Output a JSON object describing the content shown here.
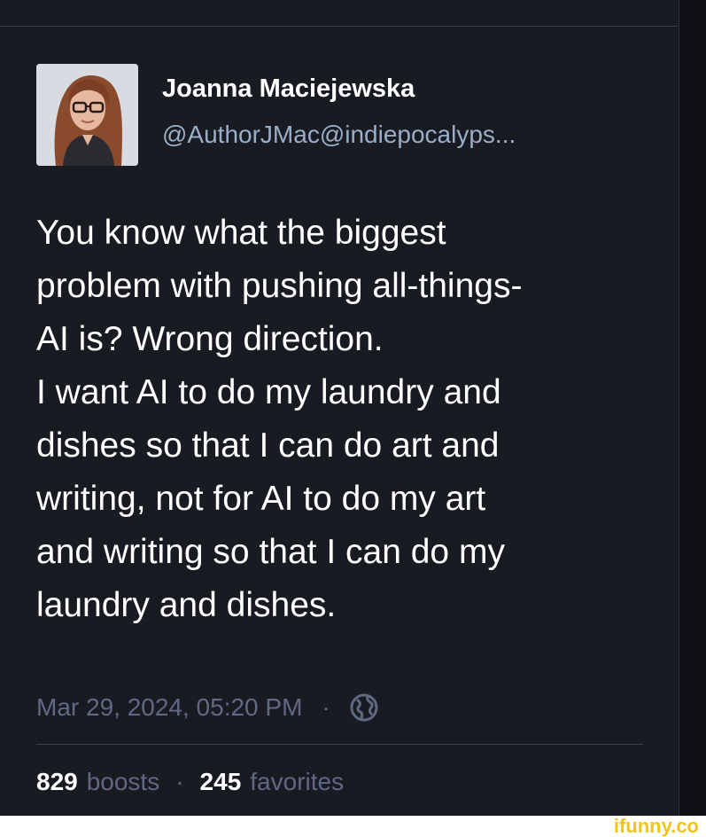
{
  "post": {
    "author": {
      "display_name": "Joanna Maciejewska",
      "handle": "@AuthorJMac@indiepocalyps..."
    },
    "content": "You know what the biggest\nproblem with pushing all-things-\nAI is? Wrong direction.\nI want AI to do my laundry and\ndishes so that I can do art and\nwriting, not for AI to do my art\nand writing so that I can do my\nlaundry and dishes.",
    "timestamp": "Mar 29, 2024, 05:20 PM",
    "separator": "·",
    "visibility_icon": "globe-icon",
    "stats": {
      "boosts_count": "829",
      "boosts_label": "boosts",
      "favorites_count": "245",
      "favorites_label": "favorites"
    }
  },
  "watermark": {
    "text": "ifunny.co"
  },
  "colors": {
    "background": "#191b22",
    "text_primary": "#ffffff",
    "text_secondary": "#9baec8",
    "text_muted": "#606984",
    "divider": "#393f4f",
    "watermark": "#f2c318"
  }
}
